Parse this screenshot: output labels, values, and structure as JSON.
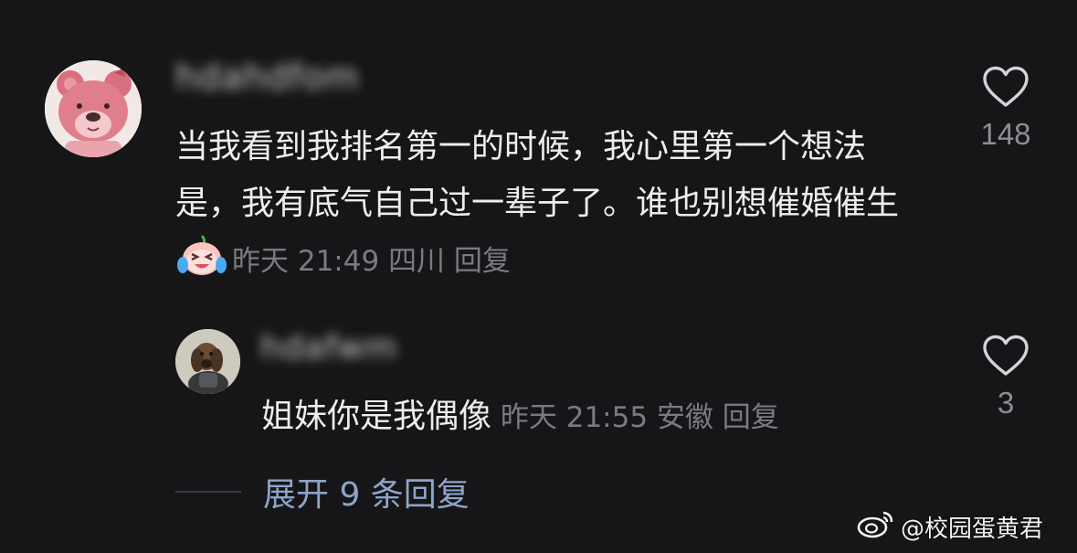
{
  "comment": {
    "username_blurred": "hdahdfom",
    "text": "当我看到我排名第一的时候，我心里第一个想法是，我有底气自己过一辈子了。谁也别想催婚催生",
    "emoji_icon": "crying-laughing-face-icon",
    "time": "昨天 21:49",
    "location": "四川",
    "reply_label": "回复",
    "like_count": "148"
  },
  "reply": {
    "username_blurred": "hdafwm",
    "text": "姐妹你是我偶像",
    "time": "昨天 21:55",
    "location": "安徽",
    "reply_label": "回复",
    "like_count": "3"
  },
  "expand": {
    "label": "展开 9 条回复"
  },
  "watermark": {
    "text": "@校园蛋黄君",
    "icon": "weibo-logo-icon"
  },
  "colors": {
    "background": "#161618",
    "text": "#ededee",
    "meta": "#7a7a80",
    "link": "#8ea4c8"
  }
}
